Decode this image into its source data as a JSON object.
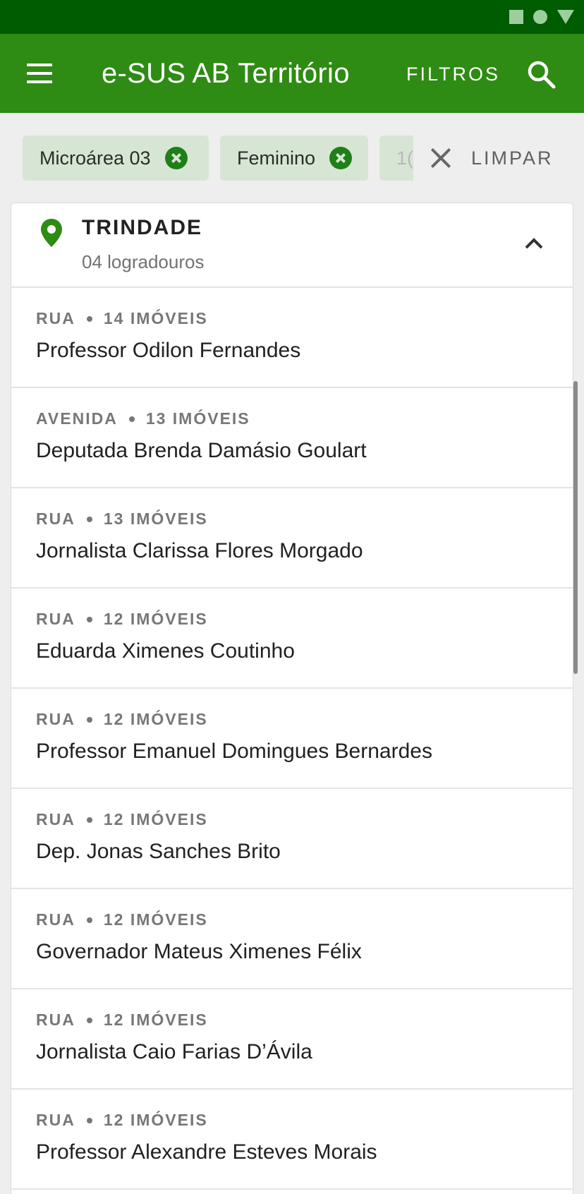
{
  "app_bar": {
    "title": "e-SUS AB Território",
    "filter_label": "FILTROS",
    "menu_icon": "menu-icon",
    "search_icon": "search-icon",
    "background_color": "#2e8b13"
  },
  "filters": {
    "chips": [
      {
        "label": "Microárea 03"
      },
      {
        "label": "Feminino"
      },
      {
        "label": "1("
      }
    ],
    "clear_label": "LIMPAR"
  },
  "bairro": {
    "name": "TRINDADE",
    "subtitle": "04 logradouros"
  },
  "logradouros": [
    {
      "type": "RUA",
      "count": "14 IMÓVEIS",
      "name": "Professor Odilon Fernandes"
    },
    {
      "type": "AVENIDA",
      "count": "13 IMÓVEIS",
      "name": "Deputada Brenda Damásio Goulart"
    },
    {
      "type": "RUA",
      "count": "13 IMÓVEIS",
      "name": "Jornalista Clarissa Flores Morgado"
    },
    {
      "type": "RUA",
      "count": "12 IMÓVEIS",
      "name": "Eduarda Ximenes Coutinho"
    },
    {
      "type": "RUA",
      "count": "12 IMÓVEIS",
      "name": "Professor Emanuel Domingues Bernardes"
    },
    {
      "type": "RUA",
      "count": "12 IMÓVEIS",
      "name": "Dep. Jonas Sanches Brito"
    },
    {
      "type": "RUA",
      "count": "12 IMÓVEIS",
      "name": "Governador Mateus Ximenes Félix"
    },
    {
      "type": "RUA",
      "count": "12 IMÓVEIS",
      "name": "Jornalista Caio Farias D’Ávila"
    },
    {
      "type": "RUA",
      "count": "12 IMÓVEIS",
      "name": "Professor Alexandre Esteves Morais"
    }
  ]
}
